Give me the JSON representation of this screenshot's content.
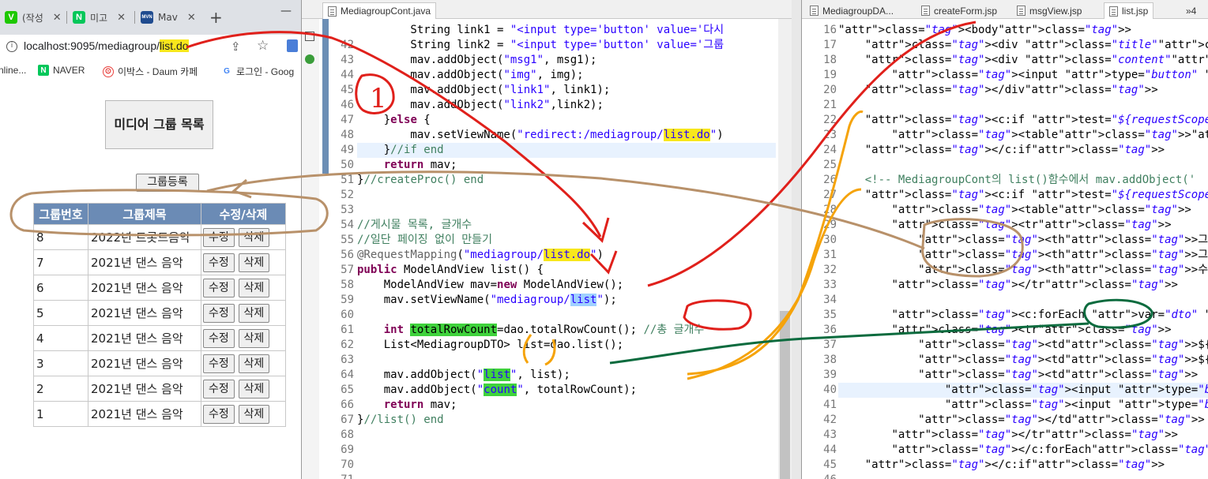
{
  "browser": {
    "tabs": [
      {
        "icon_letter": "V",
        "icon_color": "#1ec800",
        "label": "(작성"
      },
      {
        "icon_letter": "N",
        "icon_color": "#03c75a",
        "label": "미고"
      },
      {
        "icon_letter": "MVN",
        "icon_color": "#1f4b8f",
        "label": "Mav"
      }
    ],
    "new_tab": "+",
    "minimize": "—",
    "address": {
      "host": "localhost:9095/mediagroup/",
      "highlight": "list.do"
    },
    "bookmarks": [
      {
        "label": "nline...",
        "icon_letter": "",
        "icon_color": ""
      },
      {
        "label": "NAVER",
        "icon_letter": "N",
        "icon_color": "#03c75a"
      },
      {
        "label": "이박스 - Daum 카페",
        "icon_letter": "⊙",
        "icon_color": "#e8403c"
      },
      {
        "label": "로그인 - Goog",
        "icon_letter": "G",
        "icon_color": "#4285f4"
      }
    ],
    "page": {
      "title": "미디어 그룹 목록",
      "register_button": "그룹등록",
      "columns": [
        "그룹번호",
        "그룹제목",
        "수정/삭제"
      ],
      "rows": [
        {
          "no": "8",
          "title": "2022년 트롯드음악"
        },
        {
          "no": "7",
          "title": "2021년 댄스 음악"
        },
        {
          "no": "6",
          "title": "2021년 댄스 음악"
        },
        {
          "no": "5",
          "title": "2021년 댄스 음악"
        },
        {
          "no": "4",
          "title": "2021년 댄스 음악"
        },
        {
          "no": "3",
          "title": "2021년 댄스 음악"
        },
        {
          "no": "2",
          "title": "2021년 댄스 음악"
        },
        {
          "no": "1",
          "title": "2021년 댄스 음악"
        }
      ],
      "edit_label": "수정",
      "delete_label": "삭제"
    }
  },
  "java_editor": {
    "tab": "MediagroupCont.java",
    "lines": [
      {
        "n": "",
        "html": "        String link1 = \"<input type='button' value='다시"
      },
      {
        "n": "42",
        "html": "        String link2 = \"<input type='button' value='그룹"
      },
      {
        "n": "43",
        "html": "        mav.addObject(\"msg1\", msg1);"
      },
      {
        "n": "44",
        "html": "        mav.addObject(\"img\", img);"
      },
      {
        "n": "45",
        "html": "        mav.addObject(\"link1\", link1);"
      },
      {
        "n": "46",
        "html": "        mav.addObject(\"link2\",link2);"
      },
      {
        "n": "47",
        "html": "    }else {"
      },
      {
        "n": "48",
        "html": "        mav.setViewName(\"redirect:/mediagroup/list.do\")"
      },
      {
        "n": "49",
        "html": "    }//if end"
      },
      {
        "n": "50",
        "html": "    return mav;"
      },
      {
        "n": "51",
        "html": "}//createProc() end"
      },
      {
        "n": "52",
        "html": ""
      },
      {
        "n": "53",
        "html": ""
      },
      {
        "n": "54",
        "html": "//게시물 목록, 글개수"
      },
      {
        "n": "55",
        "html": "//일단 페이징 없이 만들기"
      },
      {
        "n": "56",
        "html": "@RequestMapping(\"mediagroup/list.do\")"
      },
      {
        "n": "57",
        "html": "public ModelAndView list() {"
      },
      {
        "n": "58",
        "html": "    ModelAndView mav=new ModelAndView();"
      },
      {
        "n": "59",
        "html": "    mav.setViewName(\"mediagroup/list\");"
      },
      {
        "n": "60",
        "html": ""
      },
      {
        "n": "61",
        "html": "    int totalRowCount=dao.totalRowCount(); //총 글개수"
      },
      {
        "n": "62",
        "html": "    List<MediagroupDTO> list=dao.list();"
      },
      {
        "n": "63",
        "html": ""
      },
      {
        "n": "64",
        "html": "    mav.addObject(\"list\", list);"
      },
      {
        "n": "65",
        "html": "    mav.addObject(\"count\", totalRowCount);"
      },
      {
        "n": "66",
        "html": "    return mav;"
      },
      {
        "n": "67",
        "html": "}//list() end"
      },
      {
        "n": "68",
        "html": ""
      },
      {
        "n": "69",
        "html": ""
      },
      {
        "n": "70",
        "html": ""
      },
      {
        "n": "71",
        "html": ""
      }
    ]
  },
  "jsp_editor": {
    "tabs": [
      "MediagroupDA...",
      "createForm.jsp",
      "msgView.jsp",
      "list.jsp",
      "»4"
    ],
    "lines": [
      {
        "n": "16",
        "html": "<body>"
      },
      {
        "n": "17",
        "html": "    <div class=\"title\">미디어 그룹 목록</div>"
      },
      {
        "n": "18",
        "html": "    <div class=\"content\">"
      },
      {
        "n": "19",
        "html": "        <input type=\"button\" value=\"그룹등록\" onclick=\""
      },
      {
        "n": "20",
        "html": "    </div>"
      },
      {
        "n": "21",
        "html": ""
      },
      {
        "n": "22",
        "html": "    <c:if test=\"${requestScope.count==0}\">"
      },
      {
        "n": "23",
        "html": "        <table><tr><td>게시판에 글 없음!!</td></tr></tabl"
      },
      {
        "n": "24",
        "html": "    </c:if>"
      },
      {
        "n": "25",
        "html": ""
      },
      {
        "n": "26",
        "html": "    <!-- MediagroupCont의 list()함수에서 mav.addObject('"
      },
      {
        "n": "27",
        "html": "    <c:if test=\"${requestScope.count>0}\">"
      },
      {
        "n": "28",
        "html": "        <table>"
      },
      {
        "n": "29",
        "html": "        <tr>"
      },
      {
        "n": "30",
        "html": "            <th>그룹번호</th>"
      },
      {
        "n": "31",
        "html": "            <th>그룹제목</th>"
      },
      {
        "n": "32",
        "html": "            <th>수정/삭제</th>"
      },
      {
        "n": "33",
        "html": "        </tr>"
      },
      {
        "n": "34",
        "html": ""
      },
      {
        "n": "35",
        "html": "        <c:forEach var=\"dto\" items=\"${list}\">"
      },
      {
        "n": "36",
        "html": "        <tr>"
      },
      {
        "n": "37",
        "html": "            <td>${dto.mediagroupno}</td>"
      },
      {
        "n": "38",
        "html": "            <td>${dto.title}</td>"
      },
      {
        "n": "39",
        "html": "            <td>"
      },
      {
        "n": "40",
        "html": "                <input type=\"button\" value=\"수정\">"
      },
      {
        "n": "41",
        "html": "                <input type=\"button\" value=\"삭제\">"
      },
      {
        "n": "42",
        "html": "            </td>"
      },
      {
        "n": "43",
        "html": "        </tr>"
      },
      {
        "n": "44",
        "html": "        </c:forEach>"
      },
      {
        "n": "45",
        "html": "    </c:if>"
      },
      {
        "n": "46",
        "html": ""
      }
    ]
  },
  "annotation_label": "1",
  "colors": {
    "header_blue": "#6b8bb5",
    "highlight_yellow": "#f8e71c",
    "highlight_green": "#3fd23c",
    "annotation_red": "#e0201b",
    "annotation_brown": "#b8916a",
    "annotation_orange": "#f5a30a",
    "annotation_teal": "#0b6b3e"
  }
}
